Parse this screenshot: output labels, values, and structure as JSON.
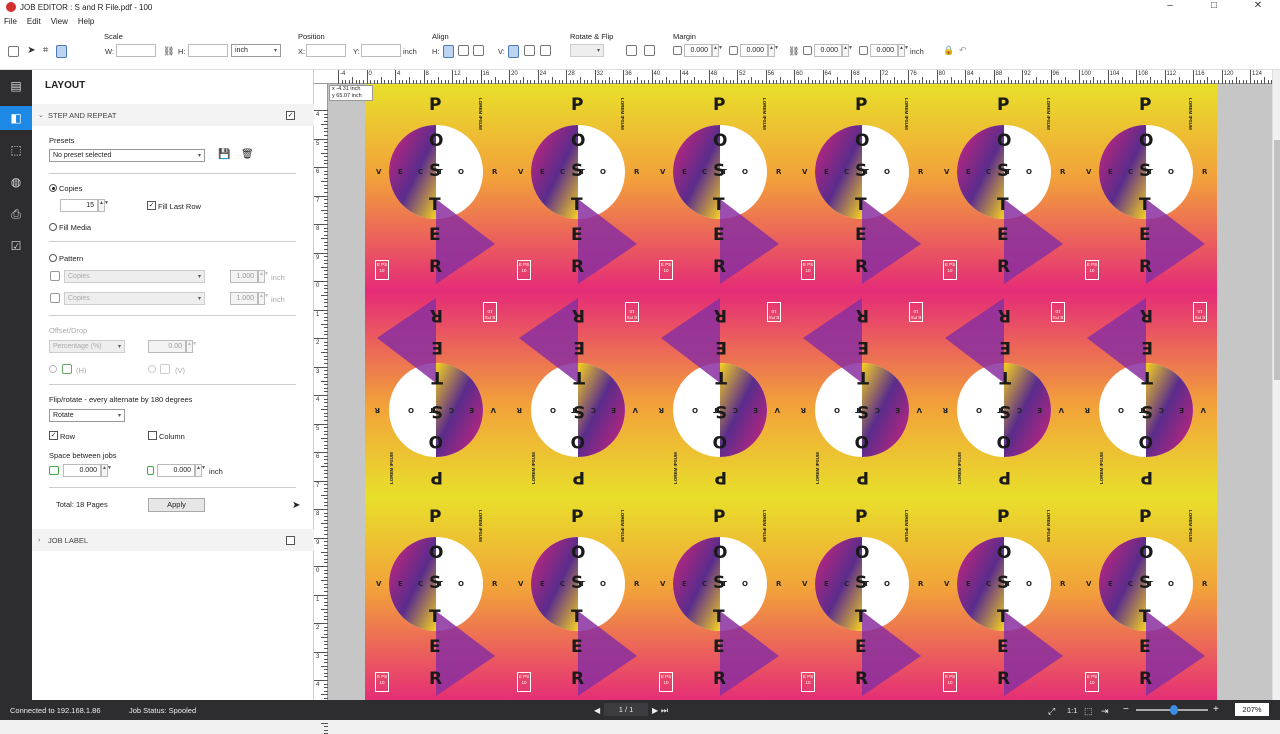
{
  "window": {
    "title": "JOB EDITOR : S and R File.pdf - 100"
  },
  "menu": [
    "File",
    "Edit",
    "View",
    "Help"
  ],
  "toolbar": {
    "scale": {
      "label": "Scale",
      "w": "W:",
      "h": "H:",
      "unit": "inch"
    },
    "position": {
      "label": "Position",
      "x": "X:",
      "y": "Y:",
      "unit": "inch"
    },
    "align": {
      "label": "Align",
      "h": "H:",
      "v": "V:"
    },
    "rotate": {
      "label": "Rotate & Flip"
    },
    "margin": {
      "label": "Margin",
      "values": [
        "0.000",
        "0.000",
        "0.000",
        "0.000"
      ],
      "unit": "inch"
    }
  },
  "panel": {
    "title": "LAYOUT",
    "step_repeat": {
      "label": "STEP AND REPEAT",
      "checked": true
    },
    "presets": {
      "label": "Presets",
      "value": "No preset selected"
    },
    "copies": {
      "label": "Copies",
      "value": "15",
      "fill_last_row": "Fill Last Row",
      "fill_media": "Fill Media"
    },
    "pattern": {
      "label": "Pattern",
      "row1": {
        "select": "Copies",
        "value": "1.000",
        "unit": "inch"
      },
      "row2": {
        "select": "Copies",
        "value": "1.000",
        "unit": "inch"
      }
    },
    "offset": {
      "label": "Offset/Drop",
      "select": "Percentage (%)",
      "value": "0.00",
      "h": "(H)",
      "v": "(V)"
    },
    "flip": {
      "label": "Flip/rotate - every alternate by 180 degrees",
      "select": "Rotate",
      "row": "Row",
      "column": "Column"
    },
    "space": {
      "label": "Space between jobs",
      "h": "0.000",
      "v": "0.000",
      "unit": "inch"
    },
    "total": "Total: 18 Pages",
    "apply": "Apply",
    "job_label": "JOB LABEL"
  },
  "canvas": {
    "coord": [
      "x -4.31 inch",
      "y 65.07 inch"
    ],
    "ruler_top": [
      "-4",
      "0",
      "4",
      "8",
      "12",
      "16",
      "20",
      "24",
      "28",
      "32",
      "36",
      "40",
      "44",
      "48",
      "52",
      "56",
      "60",
      "64",
      "68",
      "72",
      "76",
      "80",
      "84",
      "88",
      "92",
      "96",
      "100",
      "104",
      "108",
      "112",
      "116",
      "120",
      "124"
    ],
    "ruler_left": [
      "4",
      "5",
      "6",
      "7",
      "8",
      "9",
      "0",
      "1",
      "2",
      "3",
      "4",
      "5",
      "6",
      "7",
      "8",
      "9",
      "0",
      "1",
      "2",
      "3",
      "4",
      "5"
    ],
    "poster": {
      "letters": [
        "P",
        "O",
        "S",
        "T",
        "E",
        "R"
      ],
      "vector": [
        "V",
        "E",
        "C",
        "T",
        "O",
        "R"
      ],
      "side": "LOREM IPSUM",
      "badge": "E PS 10"
    }
  },
  "statusbar": {
    "connection": "Connected to 192.168.1.86",
    "job_status": "Job Status: Spooled",
    "page": "1 / 1",
    "zoom": "207%"
  }
}
